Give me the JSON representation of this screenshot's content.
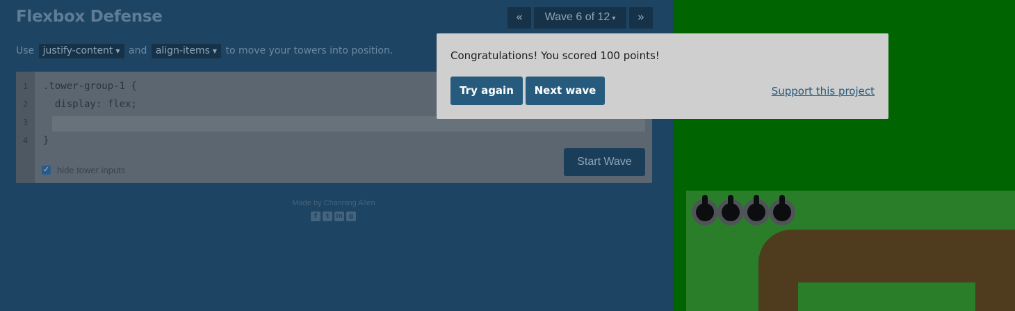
{
  "app": {
    "title": "Flexbox Defense"
  },
  "wave_nav": {
    "prev_label": "«",
    "wave_label": "Wave 6 of 12",
    "caret": "▾",
    "next_label": "»"
  },
  "instructions": {
    "prefix": "Use",
    "prop1": "justify-content",
    "joiner": "and",
    "prop2": "align-items",
    "suffix": "to move your towers into position.",
    "dropdown_glyph": "▼"
  },
  "editor": {
    "line_numbers": [
      "1",
      "2",
      "3",
      "4"
    ],
    "lines": [
      ".tower-group-1 {",
      "  display: flex;",
      "",
      "}"
    ],
    "input_value": "",
    "start_label": "Start Wave",
    "hide_inputs_label": "hide tower inputs",
    "hide_inputs_checked": true
  },
  "footer": {
    "credit": "Made by Channing Allen",
    "social_icons": [
      "facebook-icon",
      "twitter-icon",
      "linkedin-icon",
      "github-icon"
    ],
    "social_glyphs": [
      "f",
      "t",
      "in",
      "g"
    ]
  },
  "modal": {
    "message": "Congratulations! You scored 100 points!",
    "try_again_label": "Try again",
    "next_wave_label": "Next wave",
    "support_label": "Support this project"
  },
  "colors": {
    "board_green": "#006400",
    "field_green": "#2a7e2a",
    "path_brown": "#4f3b1e",
    "button_blue": "#265b7d"
  },
  "board": {
    "tower_count": 4
  }
}
